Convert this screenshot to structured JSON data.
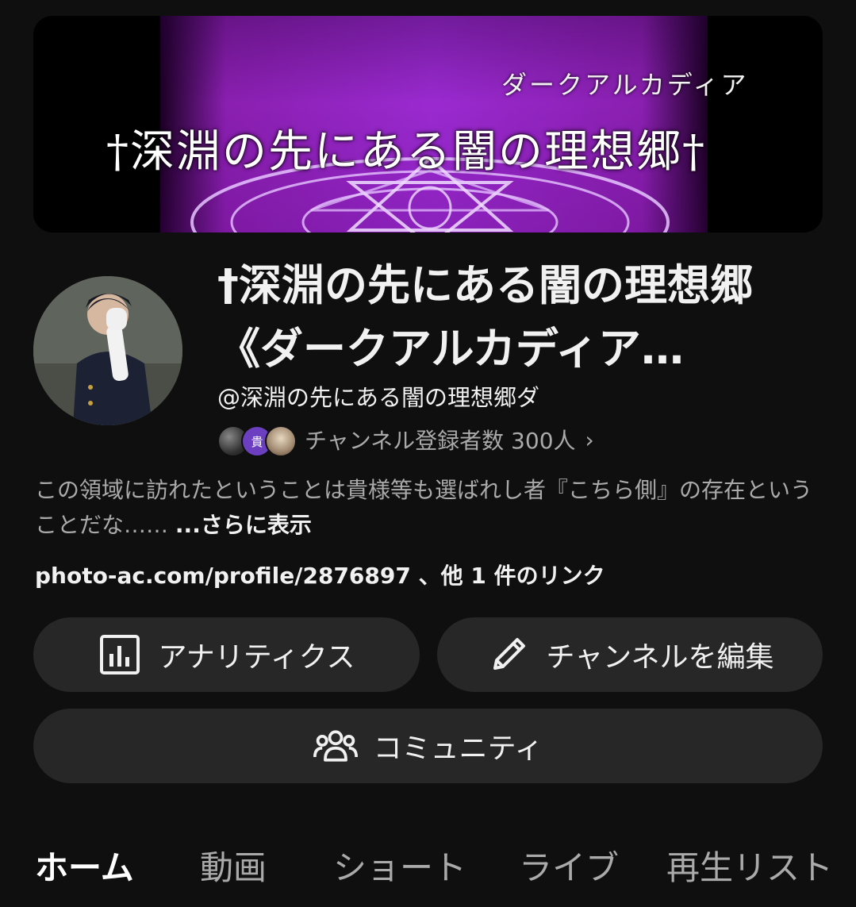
{
  "banner": {
    "subtitle": "ダークアルカディア",
    "title": "†深淵の先にある闇の理想郷†"
  },
  "channel": {
    "name": "†深淵の先にある闇の理想郷《ダークアルカディア…",
    "handle": "@深淵の先にある闇の理想郷ダ",
    "subscriber_badge_char": "貴",
    "subscribers": "チャンネル登録者数 300人",
    "subscribers_chevron": "›",
    "description": "この領域に訪れたということは貴様等も選ばれし者『こちら側』の存在ということだな……",
    "description_more": "...さらに表示",
    "links": "photo-ac.com/profile/2876897 、他 1 件のリンク"
  },
  "buttons": {
    "analytics": "アナリティクス",
    "edit_channel": "チャンネルを編集",
    "community": "コミュニティ"
  },
  "tabs": [
    "ホーム",
    "動画",
    "ショート",
    "ライブ",
    "再生リスト"
  ],
  "active_tab": "ホーム",
  "icons": {
    "analytics": "bar-chart-icon",
    "edit": "pencil-icon",
    "community": "people-icon"
  },
  "colors": {
    "background": "#0f0f0f",
    "button": "#272727",
    "text_primary": "#f1f1f1",
    "text_secondary": "#aaaaaa",
    "banner_purple": "#9a2ad0"
  }
}
